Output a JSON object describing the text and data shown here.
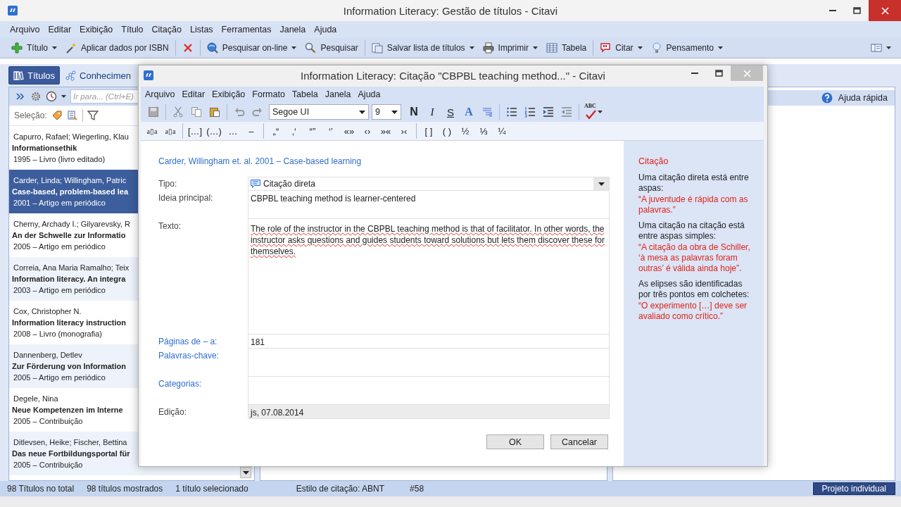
{
  "window": {
    "title": "Information Literacy: Gestão de títulos - Citavi"
  },
  "menu": [
    "Arquivo",
    "Editar",
    "Exibição",
    "Título",
    "Citação",
    "Listas",
    "Ferramentas",
    "Janela",
    "Ajuda"
  ],
  "toolbar": {
    "groups": [
      [
        {
          "label": "Título",
          "dropdown": true
        },
        {
          "label": "Aplicar dados por ISBN",
          "dropdown": false
        }
      ],
      [
        {
          "dropdown": false
        }
      ],
      [
        {
          "label": "Pesquisar on-line",
          "dropdown": true
        },
        {
          "label": "Pesquisar",
          "dropdown": false
        }
      ],
      [
        {
          "label": "Salvar lista de títulos",
          "dropdown": true
        },
        {
          "label": "Imprimir",
          "dropdown": true
        },
        {
          "label": "Tabela",
          "dropdown": false
        }
      ],
      [
        {
          "label": "Citar",
          "dropdown": true
        },
        {
          "label": "Pensamento",
          "dropdown": true
        }
      ]
    ]
  },
  "tabs": [
    {
      "label": "Títulos",
      "selected": true
    },
    {
      "label": "Conhecimen",
      "selected": false
    }
  ],
  "title_list": {
    "search": {
      "placeholder": "Ir para... (Ctrl+E)"
    },
    "selection_label": "Seleção:",
    "rows": [
      {
        "authors": "Capurro, Rafael; Wiegerling, Klau",
        "title": "Informationsethik",
        "info": "1995 – Livro (livro editado)",
        "selected": false
      },
      {
        "authors": "Carder, Linda; Willingham, Patric",
        "title": "Case-based, problem-based lea",
        "info": "2001 – Artigo em periódico",
        "selected": true
      },
      {
        "authors": "Cherny, Archady I.; Gilyarevsky, R",
        "title": "An der Schwelle zur Informatio",
        "info": "2005 – Artigo em periódico",
        "selected": false
      },
      {
        "authors": "Correia, Ana Maria Ramalho; Teix",
        "title": "Information literacy. An integra",
        "info": "2003 – Artigo em periódico",
        "selected": false
      },
      {
        "authors": "Cox, Christopher N.",
        "title": "Information literacy instruction",
        "info": "2008 – Livro (monografia)",
        "selected": false
      },
      {
        "authors": "Dannenberg, Detlev",
        "title": "Zur Förderung von Information",
        "info": "2005 – Artigo em periódico",
        "selected": false
      },
      {
        "authors": "Degele, Nina",
        "title": "Neue Kompetenzen im Interne",
        "info": "2005 – Contribuição",
        "selected": false
      },
      {
        "authors": "Ditlevsen, Heike; Fischer, Bettina",
        "title": "Das neue Fortbildungsportal für",
        "info": "2005 – Contribuição",
        "selected": false
      }
    ]
  },
  "quick_help": {
    "title": "Ajuda rápida"
  },
  "status_bar": {
    "items": [
      "98 Títulos no total",
      "98 títulos mostrados",
      "1 título selecionado",
      "Estilo de citação: ABNT",
      "#58"
    ],
    "project": "Projeto individual"
  },
  "dialog": {
    "title": "Information Literacy: Citação \"CBPBL teaching method...\" - Citavi",
    "menu": [
      "Arquivo",
      "Editar",
      "Exibição",
      "Formato",
      "Tabela",
      "Janela",
      "Ajuda"
    ],
    "font": "Segoe UI",
    "size": "9",
    "format_buttons": [
      "N",
      "I",
      "S",
      "A"
    ],
    "spellcheck": "ABC",
    "insert_groups": [
      [
        "a▯a",
        "a▯a"
      ],
      [
        "[…]",
        "(…)",
        "…",
        "–"
      ],
      [
        "„“",
        "‚‘",
        "“”",
        "‘’",
        "«»",
        "‹›",
        "»«",
        "›‹"
      ],
      [
        "[ ]",
        "( )",
        "½",
        "⅓",
        "¼"
      ]
    ],
    "reference": "Carder, Willingham et. al. 2001 – Case-based learning",
    "fields": [
      {
        "label": "Tipo:",
        "kind": "select",
        "value": "Citação direta",
        "link": false
      },
      {
        "label": "Ideia principal:",
        "kind": "medium",
        "value": "CBPBL teaching method is learner-centered",
        "link": false
      },
      {
        "label": "Texto:",
        "kind": "tall",
        "value": "The role of the instructor in the CBPBL teaching method is that of facilitator. In other words, the instructor asks questions and guides students toward solutions but lets them discover these for themselves.",
        "link": false,
        "spelling_marked": true
      },
      {
        "label": "Páginas de – a:",
        "kind": "short",
        "value": "181",
        "link": true
      },
      {
        "label": "Palavras-chave:",
        "kind": "medium",
        "link": true
      },
      {
        "label": "Categorias:",
        "kind": "medium",
        "link": true
      },
      {
        "label": "Edição:",
        "kind": "readonly",
        "value": "js, 07.08.2014",
        "link": false
      }
    ],
    "help": {
      "title": "Citação",
      "paragraphs": [
        {
          "kind": "note",
          "text": "Uma citação direta está entre aspas:"
        },
        {
          "kind": "example",
          "text": "“A juventude é rápida com as palavras.”"
        },
        {
          "kind": "note",
          "text": "Uma citação na citação está entre aspas simples:"
        },
        {
          "kind": "example",
          "text": "“A citação da obra de Schiller, ‘à mesa as palavras foram outras’ é válida ainda hoje”."
        },
        {
          "kind": "note",
          "text": "As elipses são identificadas por três pontos em colchetes:"
        },
        {
          "kind": "example",
          "text": "“O experimento […] deve ser avaliado como crítico.”"
        }
      ]
    },
    "buttons": [
      "OK",
      "Cancelar"
    ]
  }
}
